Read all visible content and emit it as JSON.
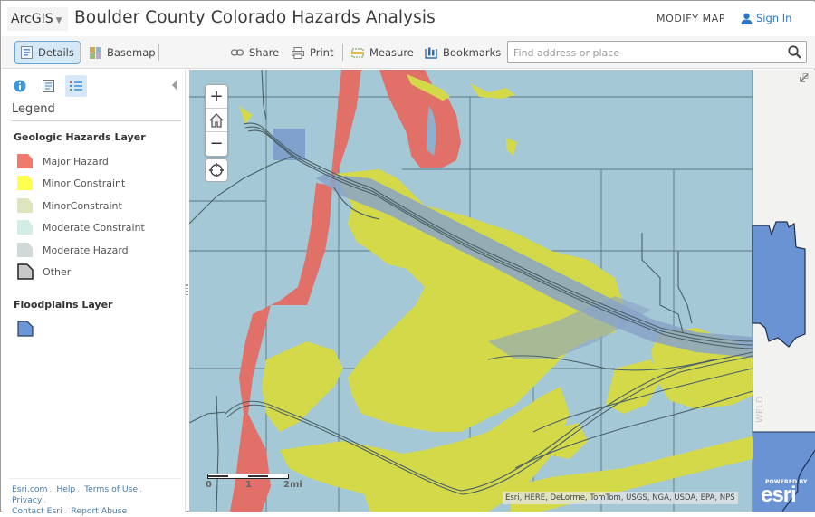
{
  "header": {
    "arcgis_label": "ArcGIS",
    "app_title": "Boulder County Colorado Hazards Analysis",
    "modify_map": "MODIFY MAP",
    "sign_in": "Sign In"
  },
  "toolbar": {
    "details": "Details",
    "basemap": "Basemap",
    "share": "Share",
    "print": "Print",
    "measure": "Measure",
    "bookmarks": "Bookmarks",
    "search_placeholder": "Find address or place",
    "search_value": ""
  },
  "sidebar": {
    "tabs": [
      {
        "name": "about",
        "icon": "info-icon"
      },
      {
        "name": "content",
        "icon": "content-icon"
      },
      {
        "name": "legend",
        "icon": "legend-icon",
        "active": true
      }
    ],
    "legend_title": "Legend",
    "layers": [
      {
        "title": "Geologic Hazards Layer",
        "items": [
          {
            "label": "Major Hazard",
            "color": "#f07b6c"
          },
          {
            "label": "Minor Constraint",
            "color": "#ffff4d"
          },
          {
            "label": "MinorConstraint",
            "color": "#dde5bf"
          },
          {
            "label": "Moderate Constraint",
            "color": "#d2ece6"
          },
          {
            "label": "Moderate Hazard",
            "color": "#cfd9d8"
          },
          {
            "label": "Other",
            "color": "#c8c8c8"
          }
        ]
      },
      {
        "title": "Floodplains Layer",
        "items": [
          {
            "label": "",
            "color": "#6b97d6"
          }
        ]
      }
    ],
    "footer_links": [
      "Esri.com",
      "Help",
      "Terms of Use",
      "Privacy",
      "Contact Esri",
      "Report Abuse"
    ]
  },
  "map": {
    "zoom_in": "+",
    "zoom_out": "−",
    "scale_labels": [
      "0",
      "1",
      "2mi"
    ],
    "attribution": "Esri, HERE, DeLorme, TomTom, USGS, NGA, USDA, EPA, NPS",
    "powered_by": "POWERED BY",
    "esri_wordmark": "esri",
    "basemap_label": "WELD",
    "colors": {
      "water_bg": "#a4c8d6",
      "major_hazard": "#e07068",
      "minor_constraint": "#d4d94a",
      "floodplain": "#7a9ccc",
      "floodplain_basemap": "#6a93d4",
      "basemap": "#f2f2f0"
    }
  }
}
